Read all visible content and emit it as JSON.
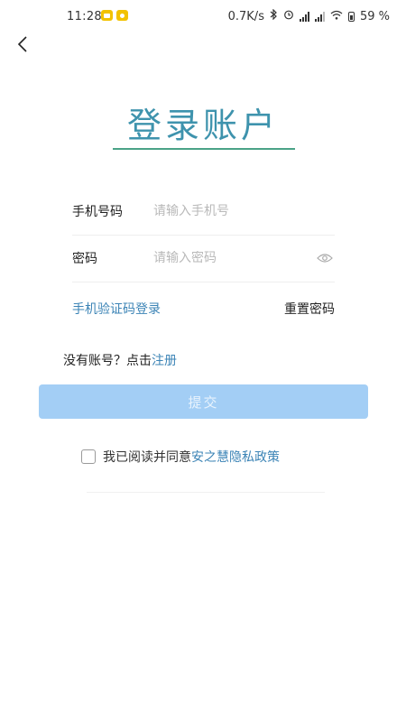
{
  "status_bar": {
    "time": "11:28",
    "network_speed": "0.7K/s",
    "battery": "59 %"
  },
  "nav": {
    "back_icon": "chevron-left-icon"
  },
  "login": {
    "title": "登录账户",
    "phone_label": "手机号码",
    "phone_placeholder": "请输入手机号",
    "password_label": "密码",
    "password_placeholder": "请输入密码",
    "sms_login": "手机验证码登录",
    "reset_password": "重置密码",
    "no_account": "没有账号？点击",
    "register": "注册",
    "submit": "提交",
    "agree_prefix": "我已阅读并同意",
    "policy": "安之慧隐私政策"
  },
  "colors": {
    "title": "#3e93ad",
    "underline": "#4aa387",
    "link": "#3c84b6",
    "submit_bg": "#a3cef5"
  }
}
